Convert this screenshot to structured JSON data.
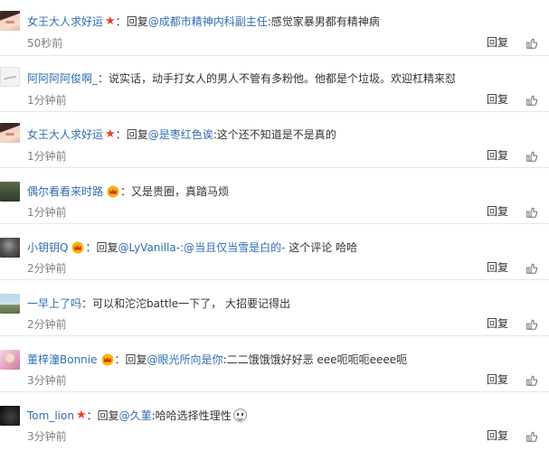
{
  "comments": [
    {
      "avatar": "avatar-girl",
      "username": "女王大人求好运",
      "badge": "star",
      "separator": "：",
      "reply_prefix": "回复",
      "mention": "@成都市精神内科副主任",
      "text": ":感觉家暴男都有精神病",
      "emoji": "",
      "time": "50秒前",
      "reply_label": "回复",
      "like_icon": "thumbs-up-icon"
    },
    {
      "avatar": "avatar-light",
      "username": "阿阿阿阿俊啊_",
      "badge": "",
      "separator": "：",
      "reply_prefix": "",
      "mention": "",
      "text": "说实话，动手打女人的男人不管有多粉他。他都是个垃圾。欢迎杠精来怼",
      "emoji": "",
      "time": "1分钟前",
      "reply_label": "回复",
      "like_icon": "thumbs-up-icon"
    },
    {
      "avatar": "avatar-girl",
      "username": "女王大人求好运",
      "badge": "star",
      "separator": "：",
      "reply_prefix": "回复",
      "mention": "@是枣红色诶",
      "text": ":这个还不知道是不是真的",
      "emoji": "",
      "time": "1分钟前",
      "reply_label": "回复",
      "like_icon": "thumbs-up-icon"
    },
    {
      "avatar": "avatar-grass",
      "username": "偶尔看看来时路",
      "badge": "crown",
      "separator": "：",
      "reply_prefix": "",
      "mention": "",
      "text": "又是贵圈，真踏马烦",
      "emoji": "",
      "time": "1分钟前",
      "reply_label": "回复",
      "like_icon": "thumbs-up-icon"
    },
    {
      "avatar": "avatar-dark",
      "username": "小钥钥Q",
      "badge": "crown",
      "separator": "：",
      "reply_prefix": "回复",
      "mention": "@LyVanilla-:@当且仅当雪是白的-",
      "text": " 这个评论 哈哈",
      "emoji": "",
      "time": "2分钟前",
      "reply_label": "回复",
      "like_icon": "thumbs-up-icon"
    },
    {
      "avatar": "avatar-sky",
      "username": "一早上了吗",
      "badge": "",
      "separator": "：",
      "reply_prefix": "",
      "mention": "",
      "text": "可以和沱沱battle一下了， 大招要记得出",
      "emoji": "",
      "time": "2分钟前",
      "reply_label": "回复",
      "like_icon": "thumbs-up-icon"
    },
    {
      "avatar": "avatar-pink",
      "username": "董梓潼Bonnie",
      "badge": "crown",
      "separator": "：",
      "reply_prefix": "回复",
      "mention": "@眼光所向是你",
      "text": ":二二饿饿饿好好恶 eee呃呃呃eeee呃",
      "emoji": "",
      "time": "3分钟前",
      "reply_label": "回复",
      "like_icon": "thumbs-up-icon"
    },
    {
      "avatar": "avatar-black",
      "username": "Tom_lion",
      "badge": "star",
      "separator": "：",
      "reply_prefix": "回复",
      "mention": "@久菫",
      "text": ":哈哈选择性理性",
      "emoji": "smile-emoji",
      "time": "3分钟前",
      "reply_label": "回复",
      "like_icon": "thumbs-up-icon"
    }
  ],
  "colors": {
    "link": "#2f6db3",
    "text": "#333333",
    "time": "#808080",
    "star": "#e8401c",
    "crown": "#f2b705",
    "divider": "#e6e6e6"
  }
}
